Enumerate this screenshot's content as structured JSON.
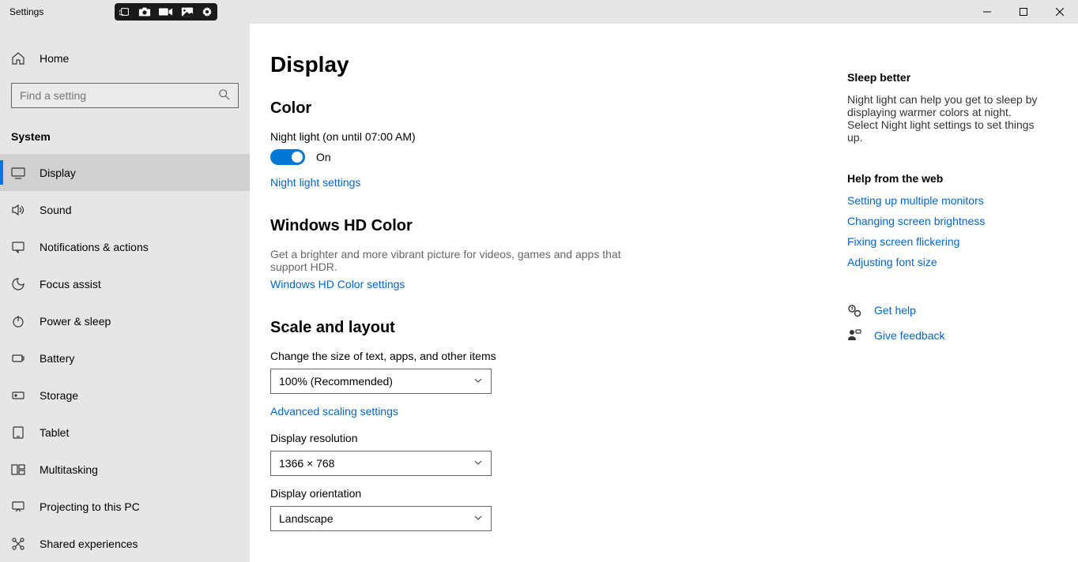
{
  "titlebar": {
    "title": "Settings"
  },
  "search": {
    "placeholder": "Find a setting"
  },
  "sidebar": {
    "home": "Home",
    "system_heading": "System",
    "items": [
      {
        "label": "Display"
      },
      {
        "label": "Sound"
      },
      {
        "label": "Notifications & actions"
      },
      {
        "label": "Focus assist"
      },
      {
        "label": "Power & sleep"
      },
      {
        "label": "Battery"
      },
      {
        "label": "Storage"
      },
      {
        "label": "Tablet"
      },
      {
        "label": "Multitasking"
      },
      {
        "label": "Projecting to this PC"
      },
      {
        "label": "Shared experiences"
      }
    ]
  },
  "main": {
    "title": "Display",
    "color": {
      "heading": "Color",
      "night_light_label": "Night light (on until 07:00 AM)",
      "toggle_state": "On",
      "settings_link": "Night light settings"
    },
    "hdcolor": {
      "heading": "Windows HD Color",
      "desc": "Get a brighter and more vibrant picture for videos, games and apps that support HDR.",
      "settings_link": "Windows HD Color settings"
    },
    "scale": {
      "heading": "Scale and layout",
      "size_label": "Change the size of text, apps, and other items",
      "size_value": "100% (Recommended)",
      "advanced_link": "Advanced scaling settings",
      "resolution_label": "Display resolution",
      "resolution_value": "1366 × 768",
      "orientation_label": "Display orientation",
      "orientation_value": "Landscape"
    }
  },
  "rpanel": {
    "sleep_heading": "Sleep better",
    "sleep_desc": "Night light can help you get to sleep by displaying warmer colors at night. Select Night light settings to set things up.",
    "help_heading": "Help from the web",
    "help_links": [
      "Setting up multiple monitors",
      "Changing screen brightness",
      "Fixing screen flickering",
      "Adjusting font size"
    ],
    "get_help": "Get help",
    "feedback": "Give feedback"
  }
}
